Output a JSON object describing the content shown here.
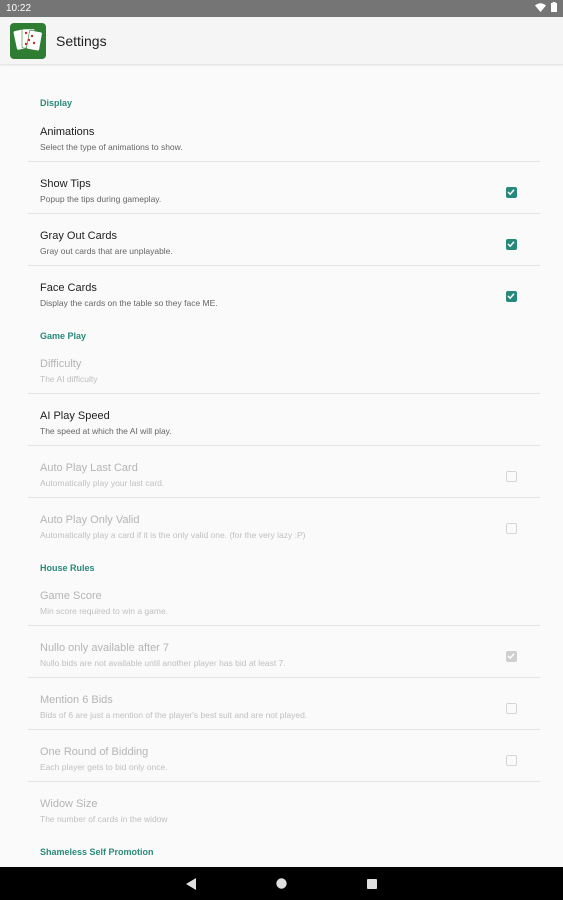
{
  "status_bar": {
    "time": "10:22"
  },
  "app_bar": {
    "title": "Settings",
    "icon": "cards-icon"
  },
  "sections": {
    "display": "Display",
    "game_play": "Game Play",
    "house_rules": "House Rules",
    "self_promotion": "Shameless Self Promotion"
  },
  "prefs": {
    "animations": {
      "title": "Animations",
      "summary": "Select the type of animations to show."
    },
    "show_tips": {
      "title": "Show Tips",
      "summary": "Popup the tips during gameplay.",
      "checked": true
    },
    "gray_out": {
      "title": "Gray Out Cards",
      "summary": "Gray out cards that are unplayable.",
      "checked": true
    },
    "face_cards": {
      "title": "Face Cards",
      "summary": "Display the cards on the table so they face ME.",
      "checked": true
    },
    "difficulty": {
      "title": "Difficulty",
      "summary": "The AI difficulty"
    },
    "ai_speed": {
      "title": "AI Play Speed",
      "summary": "The speed at which the AI will play."
    },
    "auto_last": {
      "title": "Auto Play Last Card",
      "summary": "Automatically play your last card.",
      "checked": false
    },
    "auto_valid": {
      "title": "Auto Play Only Valid",
      "summary": "Automatically play a card if it is the only valid one. (for the very lazy :P)",
      "checked": false
    },
    "game_score": {
      "title": "Game Score",
      "summary": "Min score required to win a game."
    },
    "nullo": {
      "title": "Nullo only available after 7",
      "summary": "Nullo bids are not available until another player has bid at least 7.",
      "checked": true
    },
    "mention6": {
      "title": "Mention 6 Bids",
      "summary": "Bids of 6 are just a mention of the player's best suit and are not played.",
      "checked": false
    },
    "one_round": {
      "title": "One Round of Bidding",
      "summary": "Each player gets to bid only once.",
      "checked": false
    },
    "widow": {
      "title": "Widow Size",
      "summary": "The number of cards in the widow"
    }
  },
  "colors": {
    "accent": "#26897a",
    "section": "#2a8a7a",
    "status_bar": "#757575",
    "nav_bar": "#000000"
  }
}
